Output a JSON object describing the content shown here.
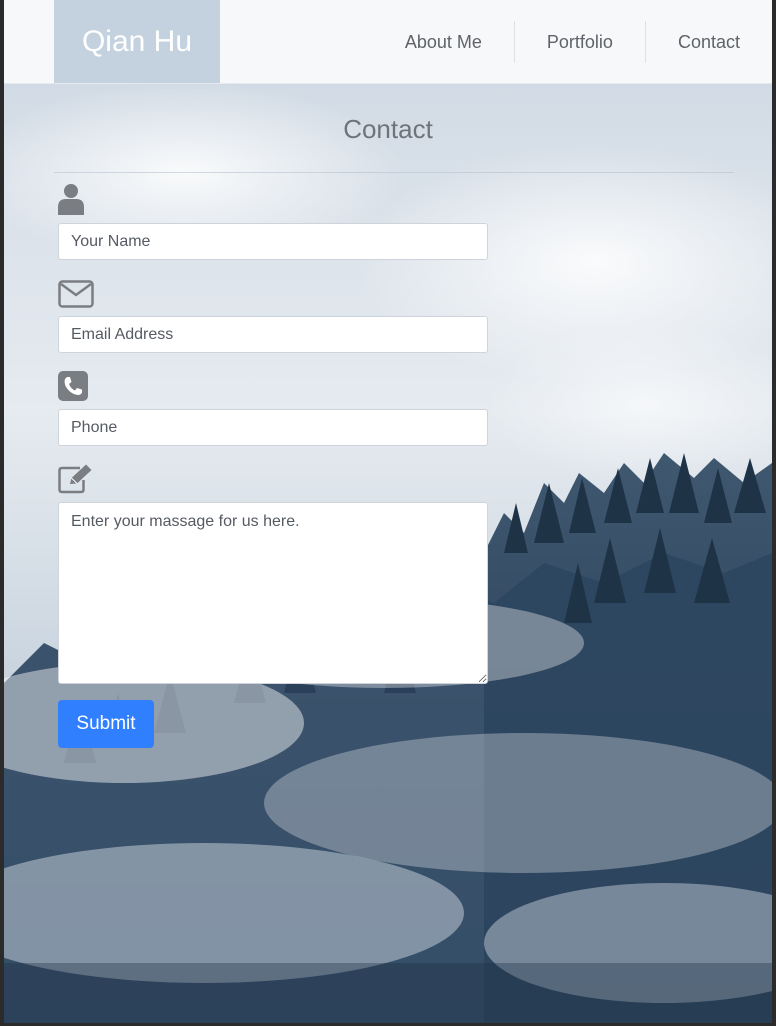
{
  "navbar": {
    "brand": "Qian Hu",
    "items": [
      {
        "label": "About Me"
      },
      {
        "label": "Portfolio"
      },
      {
        "label": "Contact"
      }
    ]
  },
  "page": {
    "title": "Contact"
  },
  "form": {
    "name": {
      "icon": "user-icon",
      "placeholder": "Your Name",
      "value": ""
    },
    "email": {
      "icon": "envelope-icon",
      "placeholder": "Email Address",
      "value": ""
    },
    "phone": {
      "icon": "phone-icon",
      "placeholder": "Phone",
      "value": ""
    },
    "message": {
      "icon": "edit-icon",
      "placeholder": "Enter your massage for us here.",
      "value": ""
    },
    "submit_label": "Submit"
  },
  "colors": {
    "accent": "#2f7fff",
    "brand_bg": "#c4d1de",
    "navbar_bg": "#f7f8fa"
  }
}
